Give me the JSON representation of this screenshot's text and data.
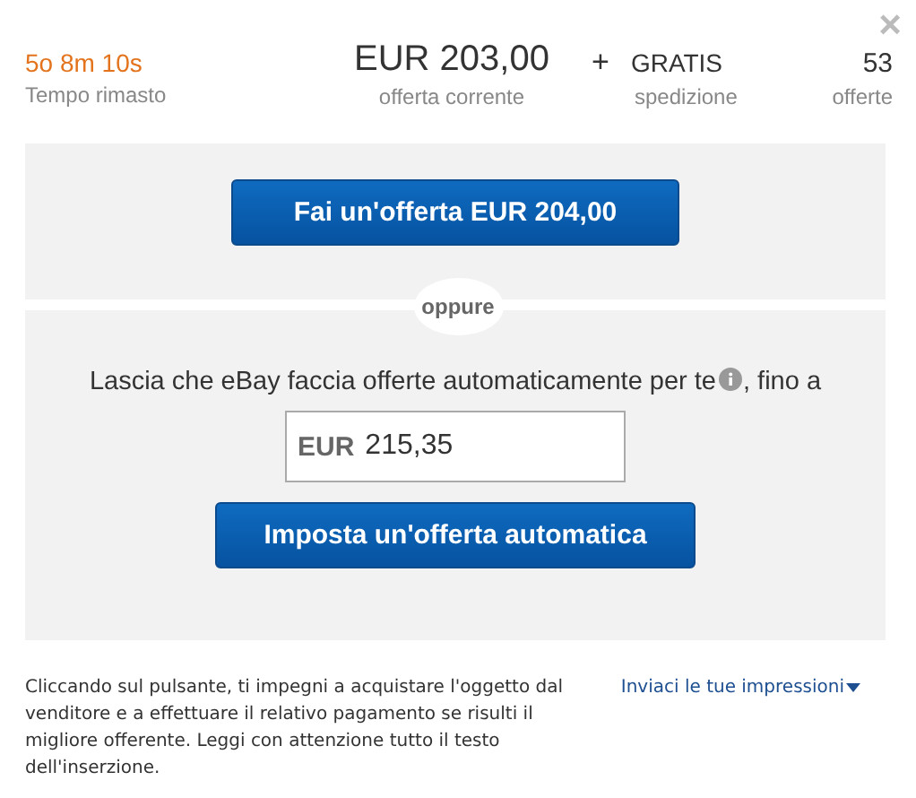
{
  "close": "×",
  "stats": [
    {
      "value": "5o 8m 10s",
      "label": "Tempo rimasto",
      "kind": "time"
    },
    {
      "value": "EUR 203,00",
      "label": "offerta corrente",
      "kind": "price"
    },
    {
      "value": "GRATIS",
      "label": "spedizione",
      "kind": "shipping",
      "prefix": "+"
    },
    {
      "value": "53",
      "label": "offerte",
      "kind": "count"
    }
  ],
  "bid_button": "Fai un'offerta EUR 204,00",
  "separator": "oppure",
  "auto_bid": {
    "text_before": "Lascia che eBay faccia offerte automaticamente per te",
    "text_after": ", fino a",
    "currency": "EUR",
    "value": "215,35",
    "button": "Imposta un'offerta automatica"
  },
  "disclaimer": "Cliccando sul pulsante, ti impegni a acquistare l'oggetto dal venditore e a effettuare il relativo pagamento se risulti il migliore offerente. Leggi con attenzione tutto il testo dell'inserzione.",
  "feedback_link": "Inviaci le tue impressioni"
}
